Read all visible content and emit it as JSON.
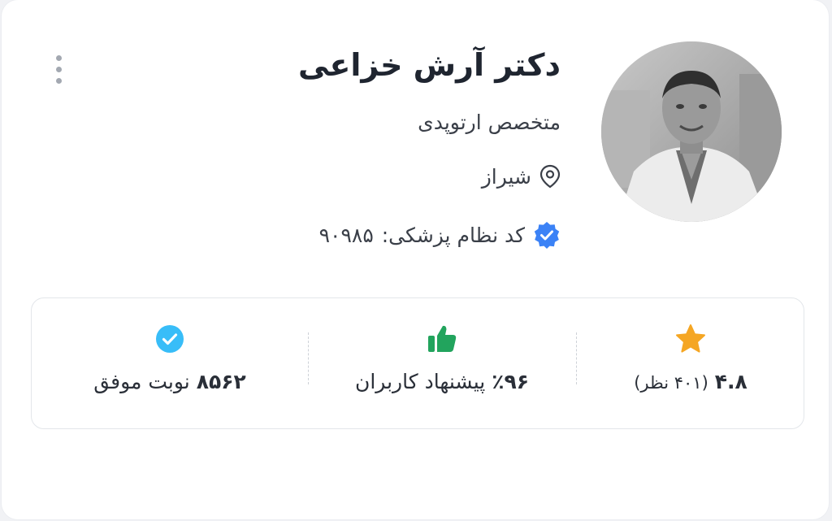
{
  "doctor": {
    "name": "دکتر آرش خزاعی",
    "specialty": "متخصص ارتوپدی",
    "city": "شیراز",
    "medical_code_label": "کد نظام پزشکی:",
    "medical_code_value": "۹۰۹۸۵"
  },
  "stats": {
    "rating_value": "۴.۸",
    "rating_count": "(۴۰۱ نظر)",
    "recommend_value": "٪۹۶",
    "recommend_label": "پیشنهاد کاربران",
    "appointments_value": "۸۵۶۲",
    "appointments_label": "نوبت موفق"
  },
  "icons": {
    "menu": "more-vertical-icon",
    "location": "location-pin-icon",
    "verified": "verified-badge-icon",
    "star": "star-icon",
    "thumbs_up": "thumbs-up-icon",
    "check": "check-circle-icon"
  },
  "colors": {
    "verified_badge": "#3b82f6",
    "star": "#f5a623",
    "thumbs_up": "#22a45d",
    "check_circle": "#38bdf8",
    "text_primary": "#1f2530",
    "text_secondary": "#3a3f48"
  }
}
